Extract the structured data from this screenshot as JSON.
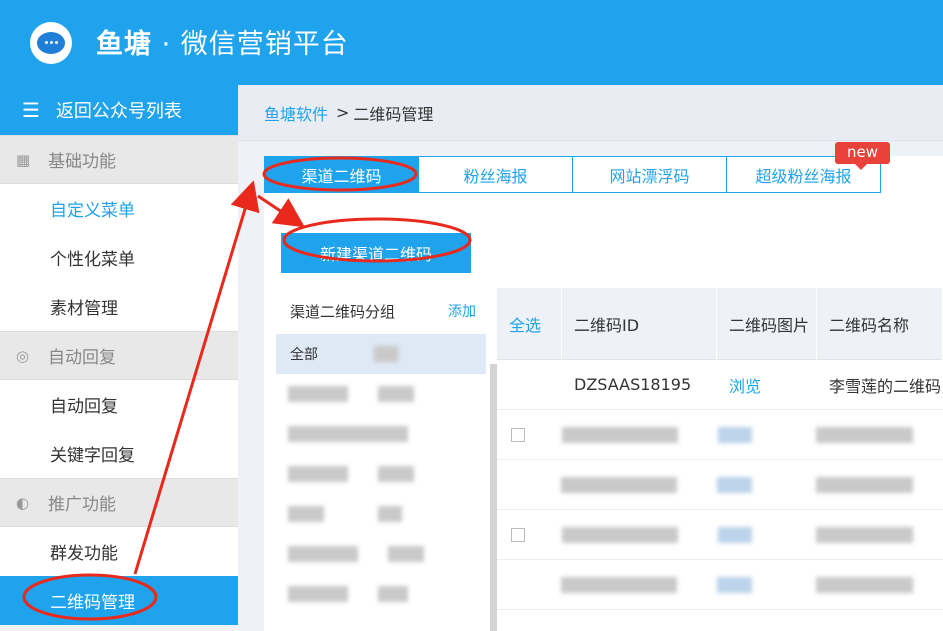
{
  "header": {
    "brand_name": "鱼塘",
    "brand_dot": "·",
    "brand_subtitle": "微信营销平台"
  },
  "sidebar": {
    "back_label": "返回公众号列表",
    "groups": [
      {
        "label": "基础功能",
        "icon": "grid-icon",
        "items": [
          "自定义菜单",
          "个性化菜单",
          "素材管理"
        ]
      },
      {
        "label": "自动回复",
        "icon": "chat-icon",
        "items": [
          "自动回复",
          "关键字回复"
        ]
      },
      {
        "label": "推广功能",
        "icon": "promote-icon",
        "items": [
          "群发功能",
          "二维码管理"
        ]
      }
    ],
    "active_item": "二维码管理"
  },
  "breadcrumb": {
    "root": "鱼塘软件",
    "separator": ">",
    "current": "二维码管理"
  },
  "tabs": [
    {
      "label": "渠道二维码",
      "active": true
    },
    {
      "label": "粉丝海报",
      "active": false
    },
    {
      "label": "网站漂浮码",
      "active": false
    },
    {
      "label": "超级粉丝海报",
      "active": false,
      "badge": "new"
    }
  ],
  "new_button": "新建渠道二维码",
  "groups_panel": {
    "title": "渠道二维码分组",
    "add_label": "添加",
    "all_label": "全部"
  },
  "table": {
    "select_all": "全选",
    "columns": [
      "二维码ID",
      "二维码图片",
      "二维码名称"
    ],
    "rows": [
      {
        "id": "DZSAAS18195",
        "image_link": "浏览",
        "name": "李雪莲的二维码"
      }
    ]
  },
  "colors": {
    "primary": "#1fa3ec",
    "badge": "#e8423b",
    "annotation": "#e8291c"
  }
}
